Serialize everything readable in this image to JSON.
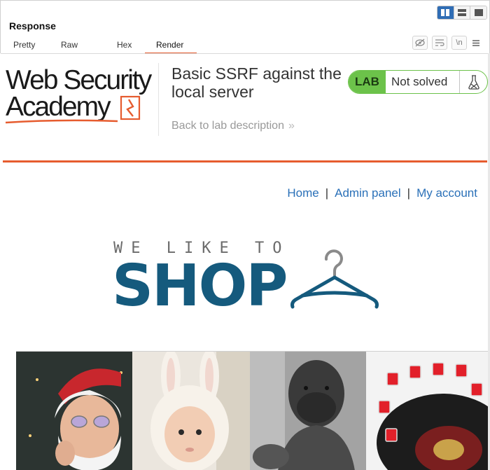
{
  "panel": {
    "title": "Response",
    "tabs": [
      "Pretty",
      "Raw",
      "Hex",
      "Render"
    ],
    "active_tab": "Render",
    "tool_icons": [
      "hide-icon",
      "wrap-lines-icon",
      "newline-icon",
      "menu-icon"
    ],
    "layout_modes": [
      "split-vertical",
      "split-horizontal",
      "single"
    ],
    "newline_label": "\\n"
  },
  "lab": {
    "logo_line1": "Web Security",
    "logo_line2": "Academy",
    "title": "Basic SSRF against the local server",
    "back_link": "Back to lab description",
    "back_chevron": "»",
    "badge": "LAB",
    "status": "Not solved"
  },
  "nav": {
    "home": "Home",
    "admin": "Admin panel",
    "account": "My account",
    "separator": "|"
  },
  "shop_logo": {
    "tagline": "WE LIKE TO",
    "word": "SHOP"
  },
  "colors": {
    "accent_orange": "#e65c2f",
    "lab_green": "#6cc24a",
    "link_blue": "#2a70b8",
    "shop_blue": "#155a7d",
    "toggle_blue": "#2f6db5"
  },
  "products": [
    "santa-photo",
    "baby-bunny-photo",
    "bulldog-bodybuilder-photo",
    "roulette-drinking-game-photo"
  ]
}
